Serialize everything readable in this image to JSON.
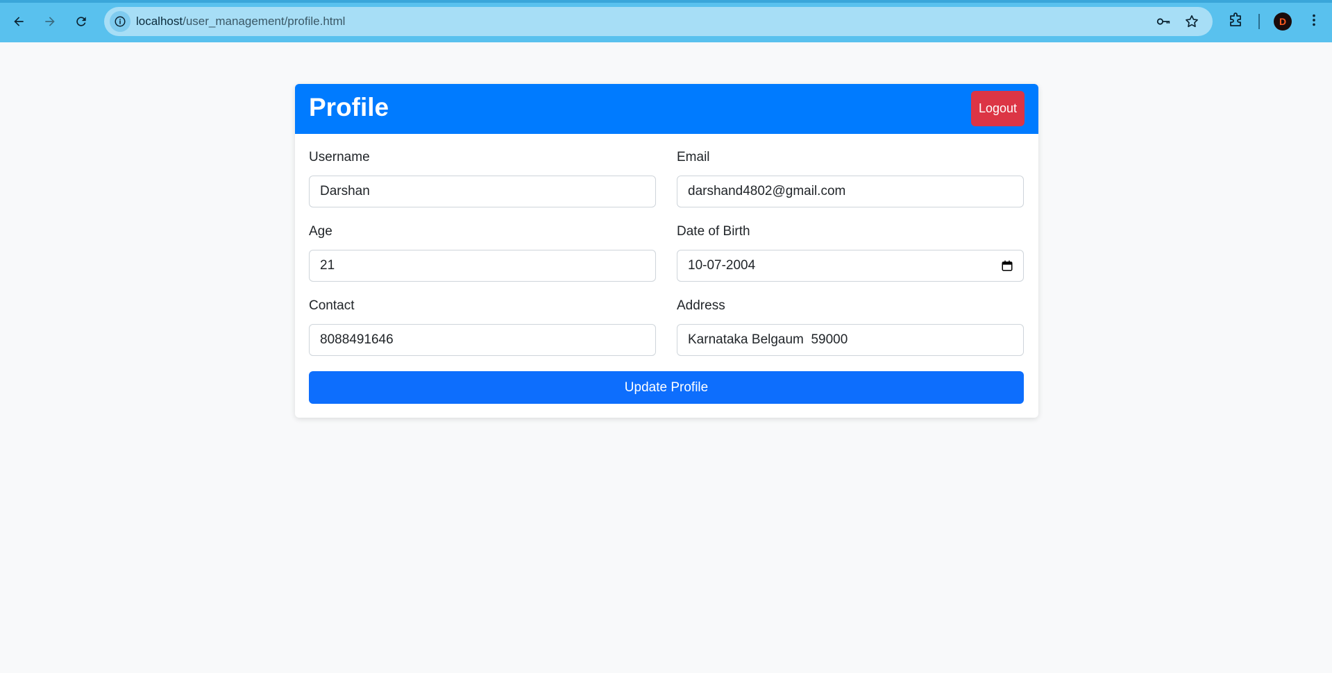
{
  "browser": {
    "url_host": "localhost",
    "url_path": "/user_management/profile.html",
    "profile_initial": "D",
    "icons": [
      "back-arrow-icon",
      "forward-arrow-icon",
      "reload-icon",
      "info-icon",
      "key-icon",
      "star-icon",
      "extensions-icon",
      "menu-icon"
    ]
  },
  "header": {
    "title": "Profile",
    "logout_label": "Logout"
  },
  "form": {
    "username": {
      "label": "Username",
      "value": "Darshan"
    },
    "email": {
      "label": "Email",
      "value": "darshand4802@gmail.com"
    },
    "age": {
      "label": "Age",
      "value": "21"
    },
    "dob": {
      "label": "Date of Birth",
      "value": "10-07-2004"
    },
    "contact": {
      "label": "Contact",
      "value": "8088491646"
    },
    "address": {
      "label": "Address",
      "value": "Karnataka Belgaum  59000"
    },
    "submit_label": "Update Profile"
  },
  "colors": {
    "header_bg": "#007bff",
    "logout_bg": "#dc3545",
    "submit_bg": "#0d6efd",
    "page_bg": "#f8f9fa",
    "chrome_bg": "#59c1ee"
  }
}
